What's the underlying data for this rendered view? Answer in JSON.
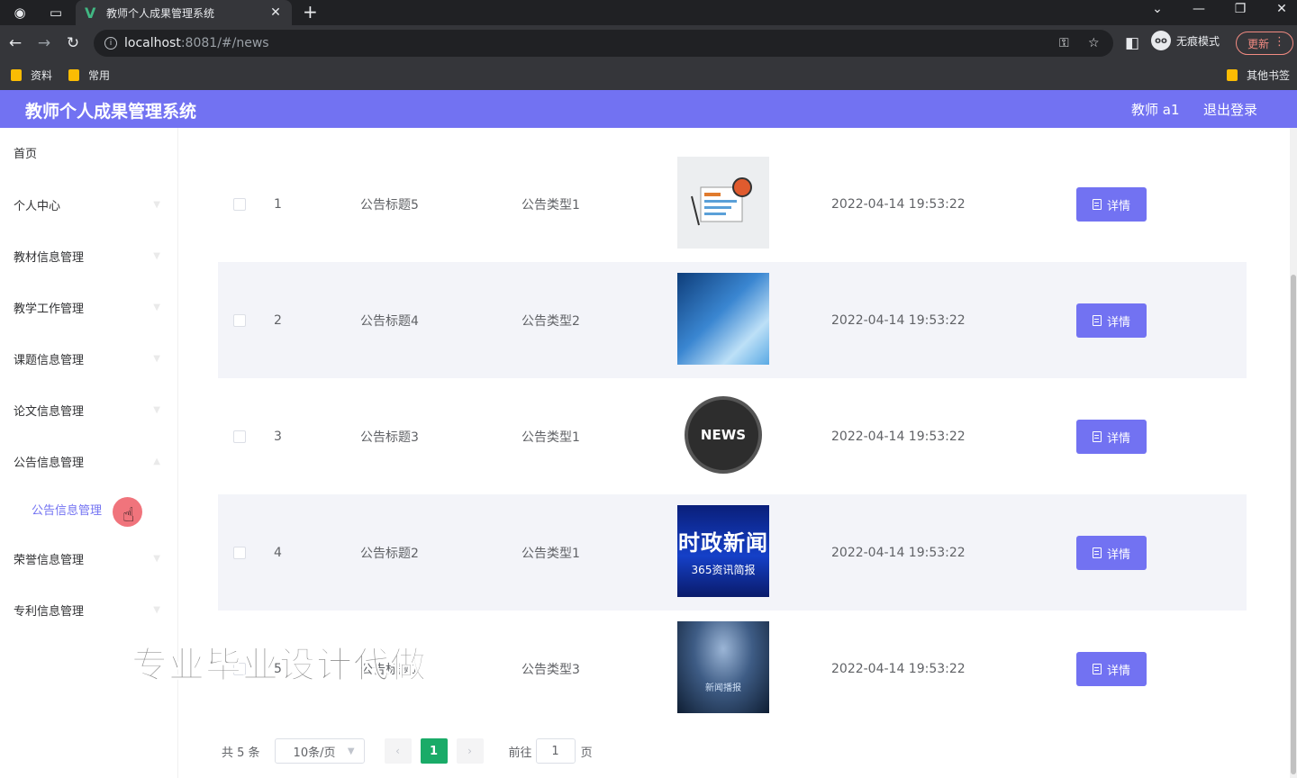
{
  "browser": {
    "tab_title": "教师个人成果管理系统",
    "url_host": "localhost",
    "url_rest": ":8081/#/news",
    "incognito_label": "无痕模式",
    "update_label": "更新",
    "bookmarks": [
      "资料",
      "常用"
    ],
    "other_bookmarks": "其他书签"
  },
  "header": {
    "title": "教师个人成果管理系统",
    "user": "教师 a1",
    "logout": "退出登录"
  },
  "sidebar": {
    "items": [
      {
        "label": "首页"
      },
      {
        "label": "个人中心"
      },
      {
        "label": "教材信息管理"
      },
      {
        "label": "教学工作管理"
      },
      {
        "label": "课题信息管理"
      },
      {
        "label": "论文信息管理"
      },
      {
        "label": "公告信息管理"
      },
      {
        "label": "公告信息管理"
      },
      {
        "label": "荣誉信息管理"
      },
      {
        "label": "专利信息管理"
      }
    ]
  },
  "table": {
    "detail_label": "详情",
    "rows": [
      {
        "index": "1",
        "title": "公告标题5",
        "type": "公告类型1",
        "time": "2022-04-14 19:53:22"
      },
      {
        "index": "2",
        "title": "公告标题4",
        "type": "公告类型2",
        "time": "2022-04-14 19:53:22"
      },
      {
        "index": "3",
        "title": "公告标题3",
        "type": "公告类型1",
        "time": "2022-04-14 19:53:22"
      },
      {
        "index": "4",
        "title": "公告标题2",
        "type": "公告类型1",
        "time": "2022-04-14 19:53:22"
      },
      {
        "index": "5",
        "title": "公告标题1",
        "type": "公告类型3",
        "time": "2022-04-14 19:53:22"
      }
    ],
    "thumbs": {
      "news_text": "NEWS",
      "t4_big": "时政新闻",
      "t4_small": "365资讯简报",
      "t5_text": "新闻播报"
    }
  },
  "pager": {
    "total": "共 5 条",
    "page_size": "10条/页",
    "current": "1",
    "goto_prefix": "前往",
    "goto_value": "1",
    "goto_suffix": "页"
  },
  "watermark": "专业毕业设计代做"
}
